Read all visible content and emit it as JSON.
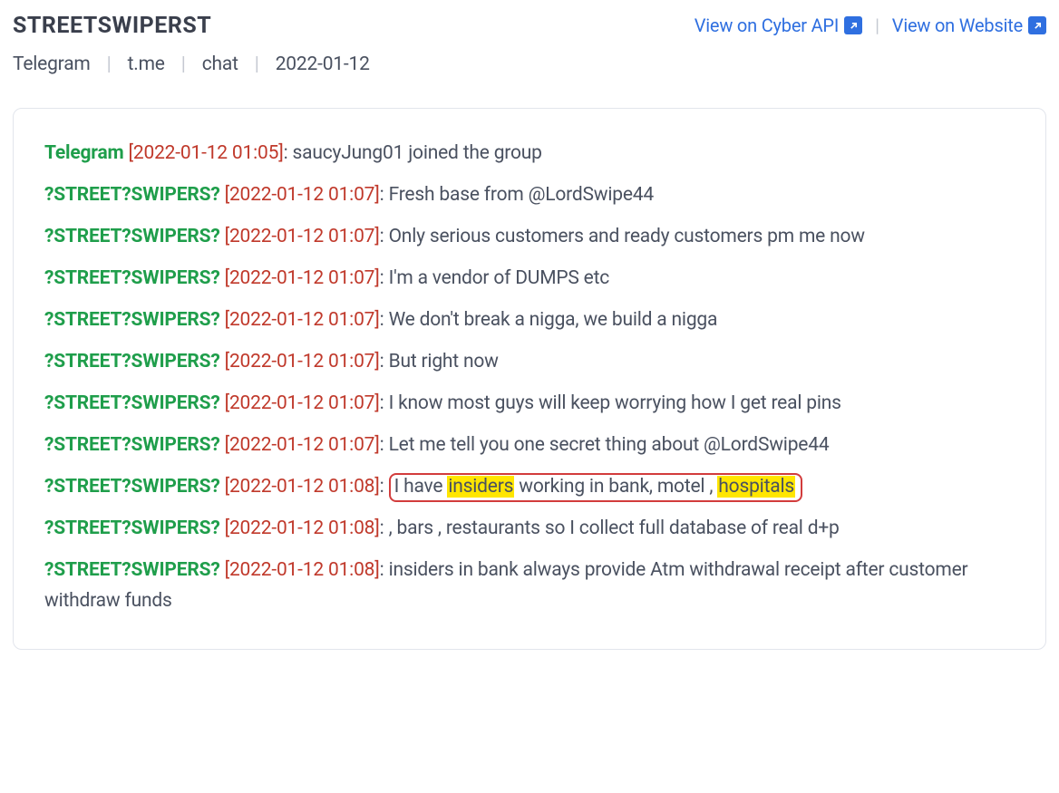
{
  "title": "STREETSWIPERST",
  "actions": {
    "api_label": "View on Cyber API",
    "web_label": "View on Website"
  },
  "meta": {
    "platform": "Telegram",
    "domain": "t.me",
    "kind": "chat",
    "date": "2022-01-12"
  },
  "users": {
    "system": "Telegram",
    "group": "?STREET?SWIPERS?"
  },
  "messages": [
    {
      "idx": 0,
      "user": "system",
      "ts": "[2022-01-12 01:05]",
      "body": "saucyJung01 joined the group"
    },
    {
      "idx": 1,
      "user": "group",
      "ts": "[2022-01-12 01:07]",
      "body": "Fresh base from @LordSwipe44"
    },
    {
      "idx": 2,
      "user": "group",
      "ts": "[2022-01-12 01:07]",
      "body": "Only serious customers and ready customers pm me now"
    },
    {
      "idx": 3,
      "user": "group",
      "ts": "[2022-01-12 01:07]",
      "body": "I'm a vendor of DUMPS etc"
    },
    {
      "idx": 4,
      "user": "group",
      "ts": "[2022-01-12 01:07]",
      "body": "We don't break a nigga, we build a nigga"
    },
    {
      "idx": 5,
      "user": "group",
      "ts": "[2022-01-12 01:07]",
      "body": "But right now"
    },
    {
      "idx": 6,
      "user": "group",
      "ts": "[2022-01-12 01:07]",
      "body": "I know most guys will keep worrying how I get real pins"
    },
    {
      "idx": 7,
      "user": "group",
      "ts": "[2022-01-12 01:07]",
      "body": "Let me tell you one secret thing about @LordSwipe44"
    },
    {
      "idx": 8,
      "user": "group",
      "ts": "[2022-01-12 01:08]",
      "highlighted": true,
      "body_pre": "I have ",
      "hl1": "insiders",
      "body_mid": " working in bank, motel , ",
      "hl2": "hospitals"
    },
    {
      "idx": 9,
      "user": "group",
      "ts": "[2022-01-12 01:08]",
      "body": ", bars , restaurants so I collect full database of real d+p"
    },
    {
      "idx": 10,
      "user": "group",
      "ts": "[2022-01-12 01:08]",
      "body": "insiders in bank always provide Atm withdrawal receipt after customer withdraw funds"
    }
  ]
}
